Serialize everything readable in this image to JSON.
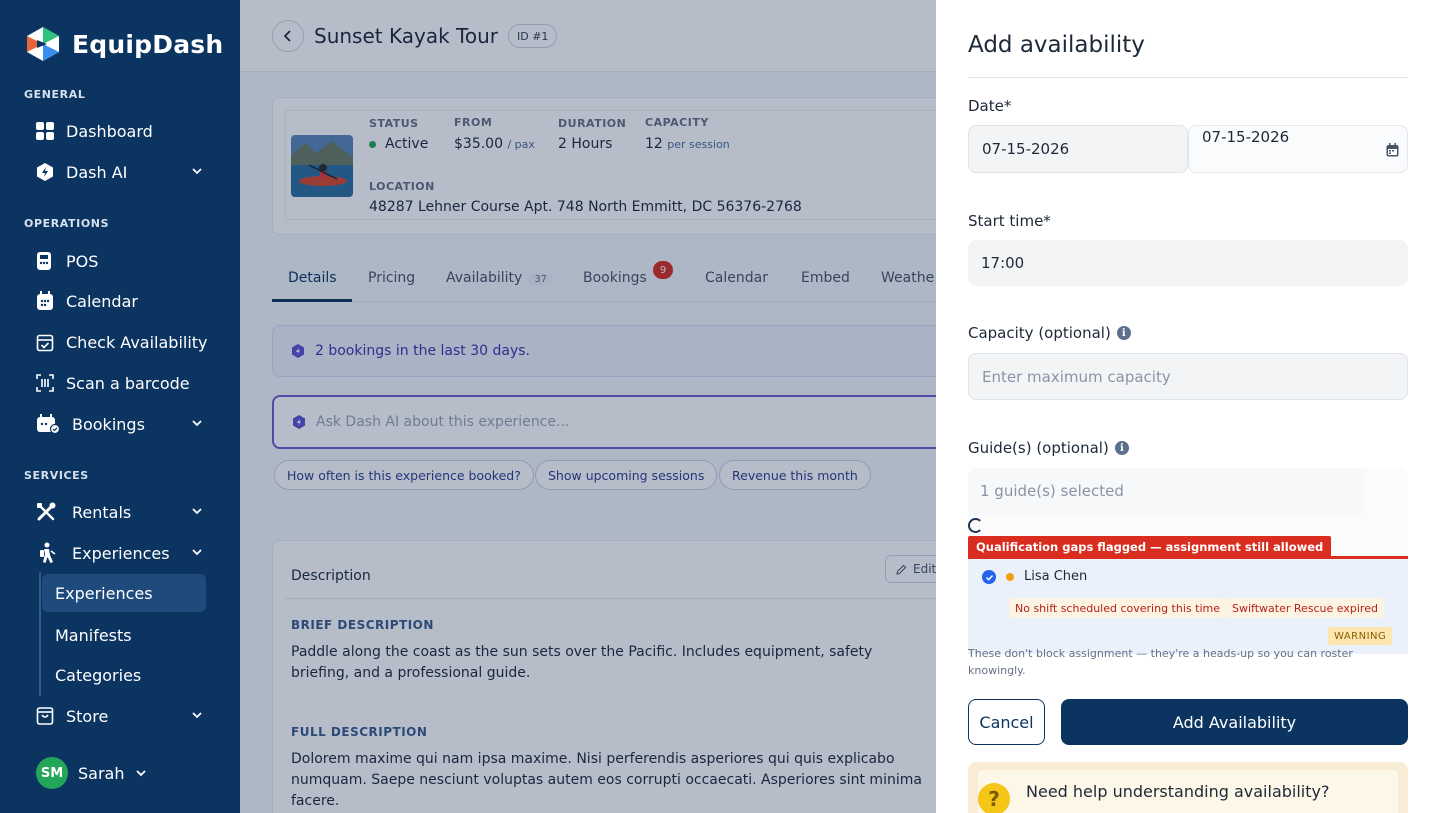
{
  "app": {
    "name": "EquipDash"
  },
  "sidebar": {
    "sections": {
      "general": "GENERAL",
      "operations": "OPERATIONS",
      "services": "SERVICES"
    },
    "items": {
      "dashboard": "Dashboard",
      "dash_ai": "Dash AI",
      "pos": "POS",
      "calendar": "Calendar",
      "check_availability": "Check Availability",
      "scan_barcode": "Scan a barcode",
      "bookings": "Bookings",
      "rentals": "Rentals",
      "experiences": "Experiences",
      "store": "Store"
    },
    "subitems": {
      "experiences": "Experiences",
      "manifests": "Manifests",
      "categories": "Categories"
    },
    "user": {
      "initials": "SM",
      "name": "Sarah"
    }
  },
  "main": {
    "title": "Sunset Kayak Tour",
    "id_badge": "ID #1",
    "info": {
      "status_label": "STATUS",
      "status_value": "Active",
      "from_label": "FROM",
      "from_value": "$35.00",
      "from_unit": "/ pax",
      "duration_label": "DURATION",
      "duration_value": "2 Hours",
      "capacity_label": "CAPACITY",
      "capacity_value": "12",
      "capacity_unit": "per session",
      "location_label": "LOCATION",
      "location_value": "48287 Lehner Course Apt. 748 North Emmitt, DC 56376-2768"
    },
    "tabs": {
      "details": "Details",
      "pricing": "Pricing",
      "availability": "Availability",
      "availability_count": "37",
      "bookings": "Bookings",
      "bookings_count": "9",
      "calendar": "Calendar",
      "embed": "Embed",
      "weather": "Weathe"
    },
    "notice": "2 bookings in the last 30 days.",
    "ask_placeholder": "Ask Dash AI about this experience...",
    "chips": [
      "How often is this experience booked?",
      "Show upcoming sessions",
      "Revenue this month"
    ],
    "description": {
      "header": "Description",
      "edit": "Edit",
      "brief_label": "BRIEF DESCRIPTION",
      "brief_text": "Paddle along the coast as the sun sets over the Pacific. Includes equipment, safety briefing, and a professional guide.",
      "full_label": "FULL DESCRIPTION",
      "full_text": "Dolorem maxime qui nam ipsa maxime. Nisi perferendis asperiores qui quis explicabo numquam. Saepe nesciunt voluptas autem eos corrupti occaecati. Asperiores sint minima facere."
    }
  },
  "panel": {
    "title": "Add availability",
    "date_label": "Date*",
    "date_value": "07-15-2026",
    "date_value_2": "07-15-2026",
    "start_label": "Start time*",
    "start_value": "17:00",
    "capacity_label": "Capacity (optional)",
    "capacity_placeholder": "Enter maximum capacity",
    "guides_label": "Guide(s) (optional)",
    "guides_value": "1 guide(s) selected",
    "flag_text": "Qualification gaps flagged — assignment still allowed",
    "guide_name": "Lisa Chen",
    "gap_1": "No shift scheduled covering this time",
    "gap_2": "Swiftwater Rescue expired",
    "warning_tag": "WARNING",
    "help_line_1": "These don't block assignment — they're a heads-up so you can roster",
    "help_line_2": "knowingly.",
    "cancel": "Cancel",
    "add": "Add Availability",
    "help_title": "Need help understanding availability?"
  },
  "colors": {
    "sidebar": "#0c3461",
    "primary": "#0c3461",
    "danger": "#d92d20",
    "accent_ai": "#6d5bd0",
    "success": "#23a55a"
  }
}
